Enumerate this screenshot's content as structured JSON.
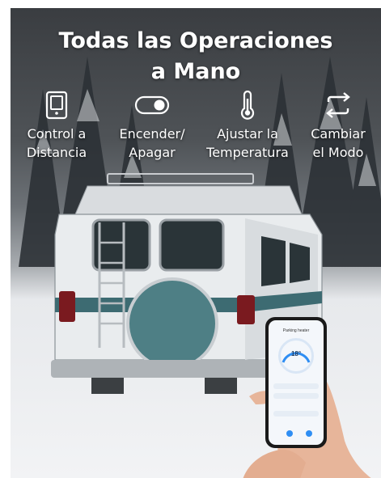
{
  "headline": {
    "line1": "Todas las Operaciones",
    "line2": "a Mano"
  },
  "features": [
    {
      "icon": "phone-remote-icon",
      "line1": "Control a",
      "line2": "Distancia"
    },
    {
      "icon": "power-toggle-icon",
      "line1": "Encender/",
      "line2": "Apagar"
    },
    {
      "icon": "thermometer-icon",
      "line1": "Ajustar la",
      "line2": "Temperatura"
    },
    {
      "icon": "swap-mode-icon",
      "line1": "Cambiar",
      "line2": "el Modo"
    }
  ],
  "phone_app": {
    "title": "Parking heater",
    "temperature": "18°"
  },
  "colors": {
    "text": "#ffffff",
    "accent": "#2f8ef3",
    "van_body": "#e9ecee",
    "van_stripe": "#3d6b72"
  }
}
